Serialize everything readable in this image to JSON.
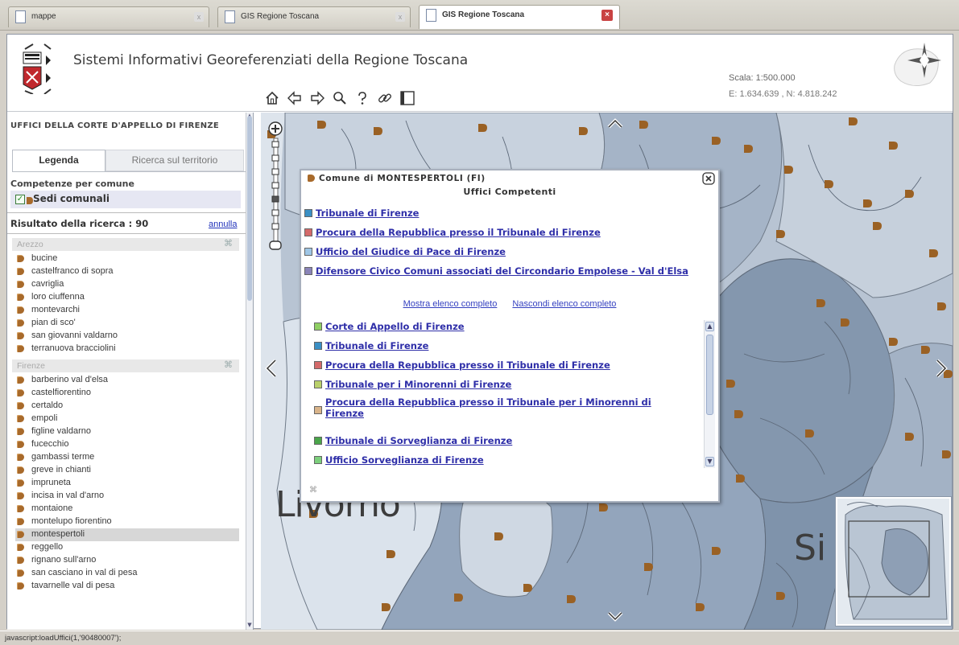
{
  "browser": {
    "tabs": [
      {
        "label": "mappe",
        "active": false
      },
      {
        "label": "GIS Regione Toscana",
        "active": false
      },
      {
        "label": "GIS Regione Toscana",
        "active": true
      }
    ],
    "status": "javascript:loadUffici(1,'90480007');"
  },
  "header": {
    "title": "Sistemi Informativi Georeferenziati della Regione Toscana",
    "scale": "Scala: 1:500.000",
    "coords": "E: 1.634.639 , N: 4.818.242",
    "toolbar_icons": [
      "home-icon",
      "back-arrow-icon",
      "forward-arrow-icon",
      "zoom-icon",
      "help-icon",
      "link-icon",
      "panel-icon"
    ]
  },
  "left_panel": {
    "title": "UFFICI DELLA CORTE D'APPELLO DI FIRENZE",
    "tabs": [
      "Legenda",
      "Ricerca sul territorio"
    ],
    "competenze_title": "Competenze per comune",
    "legend_item": "Sedi comunali",
    "result_label": "Risultato della ricerca : 90",
    "annulla": "annulla",
    "groups": [
      {
        "name": "Arezzo",
        "items": [
          "bucine",
          "castelfranco di sopra",
          "cavriglia",
          "loro ciuffenna",
          "montevarchi",
          "pian di sco'",
          "san giovanni valdarno",
          "terranuova bracciolini"
        ]
      },
      {
        "name": "Firenze",
        "items": [
          "barberino val d'elsa",
          "castelfiorentino",
          "certaldo",
          "empoli",
          "figline valdarno",
          "fucecchio",
          "gambassi terme",
          "greve in chianti",
          "impruneta",
          "incisa in val d'arno",
          "montaione",
          "montelupo fiorentino",
          "montespertoli",
          "reggello",
          "rignano sull'arno",
          "san casciano in val di pesa",
          "tavarnelle val di pesa"
        ]
      }
    ],
    "selected_item": "montespertoli"
  },
  "popup": {
    "title": "Comune di MONTESPERTOLI (FI)",
    "subtitle": "Uffici Competenti",
    "offices": [
      {
        "label": "Tribunale di Firenze",
        "color": "#3a8fc4"
      },
      {
        "label": "Procura della Repubblica presso il Tribunale di Firenze",
        "color": "#d46a6a"
      },
      {
        "label": "Ufficio del Giudice di Pace di Firenze",
        "color": "#9fc6e6"
      },
      {
        "label": "Difensore Civico Comuni associati del Circondario Empolese - Val d'Elsa",
        "color": "#8a84b8"
      }
    ],
    "show_all": "Mostra elenco completo",
    "hide_all": "Nascondi elenco completo",
    "full_list": [
      {
        "label": "Corte di Appello di Firenze",
        "color": "#8fcf63"
      },
      {
        "label": "Tribunale di Firenze",
        "color": "#3a8fc4"
      },
      {
        "label": "Procura della Repubblica presso il Tribunale di Firenze",
        "color": "#d46a6a"
      },
      {
        "label": "Tribunale per i Minorenni di Firenze",
        "color": "#b9d06a"
      },
      {
        "label": "Procura della Repubblica presso il Tribunale per i Minorenni di",
        "label2": "Firenze",
        "color": "#d9b48a"
      },
      {
        "label": "Tribunale di Sorveglianza di Firenze",
        "color": "#4aa54a"
      },
      {
        "label": "Ufficio Sorveglianza di Firenze",
        "color": "#7ccf7c"
      }
    ]
  },
  "map": {
    "label_livorno": "Livorno",
    "label_si": "Si"
  }
}
